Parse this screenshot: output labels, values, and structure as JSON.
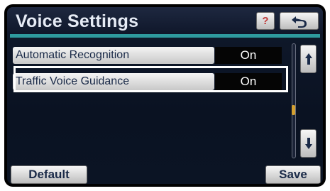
{
  "header": {
    "title": "Voice Settings",
    "help_label": "?"
  },
  "icons": {
    "back": "back-arrow-icon",
    "scroll_up": "scroll-up-arrow-icon",
    "scroll_down": "scroll-down-arrow-icon"
  },
  "settings": {
    "items": [
      {
        "label": "Automatic Recognition",
        "value": "On"
      },
      {
        "label": "Traffic Voice Guidance",
        "value": "On"
      }
    ],
    "selected_index": 1
  },
  "footer": {
    "default_label": "Default",
    "save_label": "Save"
  },
  "colors": {
    "accent": "#2e9a9e",
    "screen_background": "#0b1424",
    "button_text": "#1a2a48",
    "scroll_thumb": "#d4a030"
  }
}
